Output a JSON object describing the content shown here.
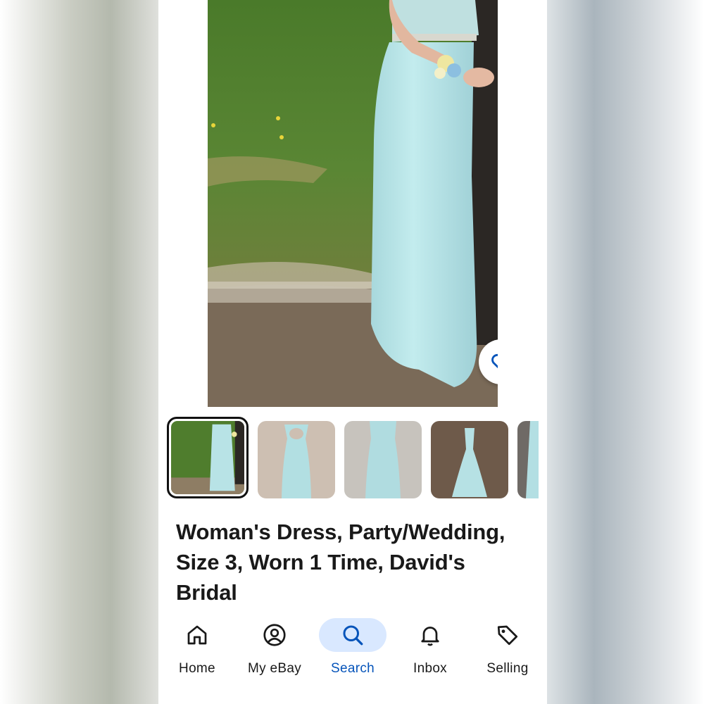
{
  "listing": {
    "title": "Woman's Dress, Party/Wedding, Size 3, Worn 1 Time, David's Bridal",
    "main_photo_icon": "dress-photo",
    "favorite_icon": "heart-icon",
    "thumbnails": [
      {
        "icon": "dress-on-grass-photo",
        "selected": true
      },
      {
        "icon": "dress-back-hanging-photo",
        "selected": false
      },
      {
        "icon": "dress-front-hanging-photo",
        "selected": false
      },
      {
        "icon": "dress-on-carpet-photo",
        "selected": false
      },
      {
        "icon": "dress-partial-photo",
        "selected": false
      }
    ]
  },
  "bottom_nav": {
    "items": [
      {
        "label": "Home",
        "icon": "home-icon",
        "active": false
      },
      {
        "label": "My eBay",
        "icon": "user-circle-icon",
        "active": false
      },
      {
        "label": "Search",
        "icon": "search-icon",
        "active": true
      },
      {
        "label": "Inbox",
        "icon": "bell-icon",
        "active": false
      },
      {
        "label": "Selling",
        "icon": "tag-icon",
        "active": false
      }
    ]
  },
  "colors": {
    "accent": "#0654ba",
    "active_pill": "#d9e8ff",
    "dress": "#b7e4e6",
    "grass": "#4f7a2e"
  }
}
